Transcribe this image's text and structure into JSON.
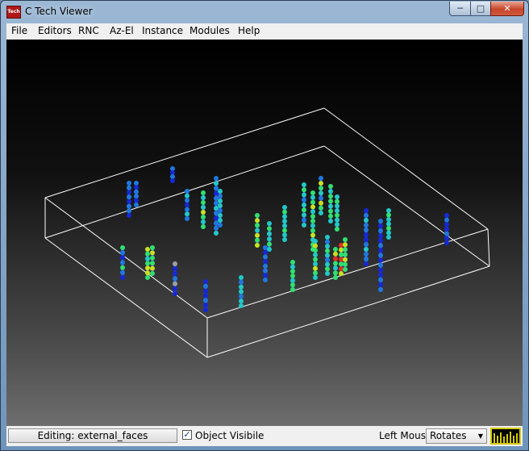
{
  "window": {
    "title": "C Tech Viewer",
    "app_icon_text": "Tech",
    "minimize_icon": "minimize-icon",
    "maximize_icon": "maximize-icon",
    "close_icon": "close-icon"
  },
  "menu": [
    "File",
    "Editors",
    "RNC",
    "Az-El",
    "Instance",
    "Modules",
    "Help"
  ],
  "status": {
    "editing": "Editing: external_faces",
    "object_visible_label": "Object Visibile",
    "object_visible_checked": true,
    "left_mouse_label": "Left Mouse",
    "left_mouse_mode": "Rotates",
    "meter_icon": "level-meter-icon",
    "meter_color": "#d4c900"
  },
  "scene": {
    "background_top": "#000000",
    "background_bottom": "#6e6e6e",
    "box_color": "#ffffff",
    "color_scale": [
      "#1428d8",
      "#1f78e0",
      "#22c8c8",
      "#30e070",
      "#c8e020",
      "#e03020"
    ]
  }
}
